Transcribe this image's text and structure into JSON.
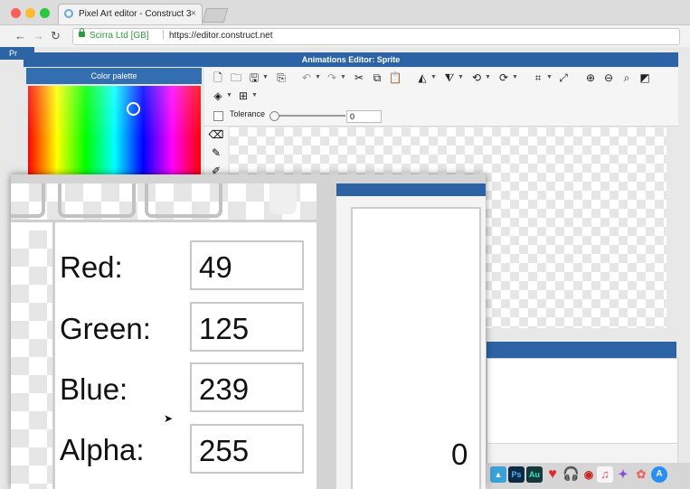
{
  "browser": {
    "tab_title": "Pixel Art editor - Construct 3",
    "tab_close": "×",
    "site_identity": "Scirra Ltd [GB]",
    "url": "https://editor.construct.net"
  },
  "page_sliver_text": "Pr",
  "animations_editor": {
    "title": "Animations Editor: Sprite",
    "color_palette_title": "Color palette",
    "tolerance_label": "Tolerance",
    "tolerance_value": "0"
  },
  "color_values": [
    {
      "label": "Red:",
      "value": "49"
    },
    {
      "label": "Green:",
      "value": "125"
    },
    {
      "label": "Blue:",
      "value": "239"
    },
    {
      "label": "Alpha:",
      "value": "255"
    }
  ],
  "zoom_counter": "0",
  "dock_icons": [
    "Ps",
    "Au"
  ],
  "colors": {
    "title_blue": "#2c63a5",
    "picked_color": "#317def"
  }
}
